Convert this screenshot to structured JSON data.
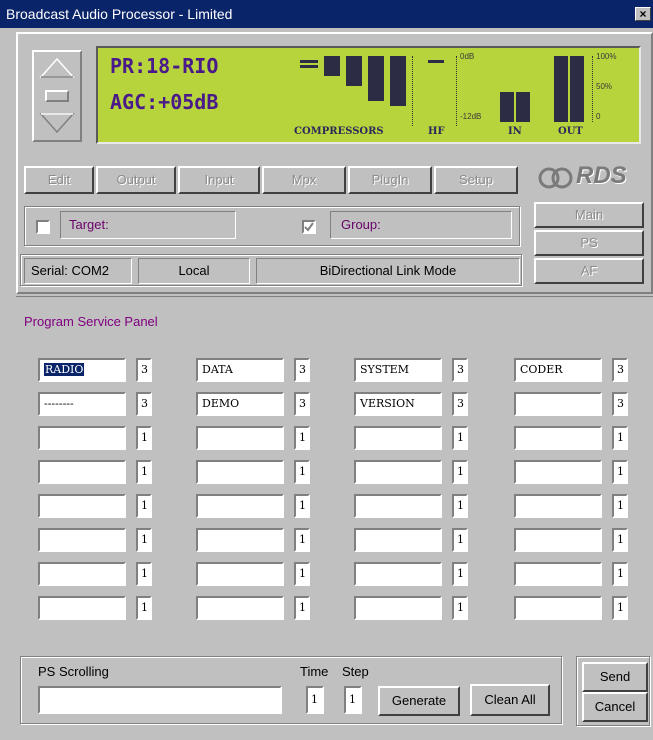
{
  "window": {
    "title": "Broadcast Audio Processor - Limited",
    "close_label": "×"
  },
  "display": {
    "line1": "PR:18-RIO",
    "line2": "AGC:+05dB",
    "compressors_label": "COMPRESSORS",
    "hf_label": "HF",
    "in_label": "IN",
    "out_label": "OUT",
    "scale_0db": "0dB",
    "scale_12db": "-12dB",
    "scale_100": "100%",
    "scale_50": "50%",
    "scale_0": "0"
  },
  "toolbar": {
    "tabs": [
      "Edit",
      "Output",
      "Input",
      "Mpx",
      "PlugIn",
      "Setup"
    ]
  },
  "rds": {
    "logo": "RDS",
    "buttons": [
      "Main",
      "PS",
      "AF"
    ]
  },
  "target": {
    "label": "Target:",
    "checked": false
  },
  "group": {
    "label": "Group:",
    "checked": true
  },
  "status": {
    "serial": "Serial: COM2",
    "location": "Local",
    "mode": "BiDirectional Link Mode"
  },
  "panel": {
    "title": "Program Service Panel",
    "rows": [
      [
        {
          "text": "RADIO",
          "num": "3"
        },
        {
          "text": "DATA",
          "num": "3"
        },
        {
          "text": "SYSTEM",
          "num": "3"
        },
        {
          "text": "CODER",
          "num": "3"
        }
      ],
      [
        {
          "text": "--------",
          "num": "3"
        },
        {
          "text": "DEMO",
          "num": "3"
        },
        {
          "text": "VERSION",
          "num": "3"
        },
        {
          "text": "",
          "num": "3"
        }
      ],
      [
        {
          "text": "",
          "num": "1"
        },
        {
          "text": "",
          "num": "1"
        },
        {
          "text": "",
          "num": "1"
        },
        {
          "text": "",
          "num": "1"
        }
      ],
      [
        {
          "text": "",
          "num": "1"
        },
        {
          "text": "",
          "num": "1"
        },
        {
          "text": "",
          "num": "1"
        },
        {
          "text": "",
          "num": "1"
        }
      ],
      [
        {
          "text": "",
          "num": "1"
        },
        {
          "text": "",
          "num": "1"
        },
        {
          "text": "",
          "num": "1"
        },
        {
          "text": "",
          "num": "1"
        }
      ],
      [
        {
          "text": "",
          "num": "1"
        },
        {
          "text": "",
          "num": "1"
        },
        {
          "text": "",
          "num": "1"
        },
        {
          "text": "",
          "num": "1"
        }
      ],
      [
        {
          "text": "",
          "num": "1"
        },
        {
          "text": "",
          "num": "1"
        },
        {
          "text": "",
          "num": "1"
        },
        {
          "text": "",
          "num": "1"
        }
      ],
      [
        {
          "text": "",
          "num": "1"
        },
        {
          "text": "",
          "num": "1"
        },
        {
          "text": "",
          "num": "1"
        },
        {
          "text": "",
          "num": "1"
        }
      ]
    ]
  },
  "scrolling": {
    "label": "PS Scrolling",
    "value": "",
    "time_label": "Time",
    "step_label": "Step",
    "time_value": "1",
    "step_value": "1",
    "generate_label": "Generate",
    "clear_label": "Clean All"
  },
  "actions": {
    "send_label": "Send",
    "cancel_label": "Cancel"
  },
  "colors": {
    "lcd": "#b7d43c",
    "lcd_text": "#4a1a8a",
    "titlebar": "#0a246a",
    "panel_title": "#800080"
  }
}
